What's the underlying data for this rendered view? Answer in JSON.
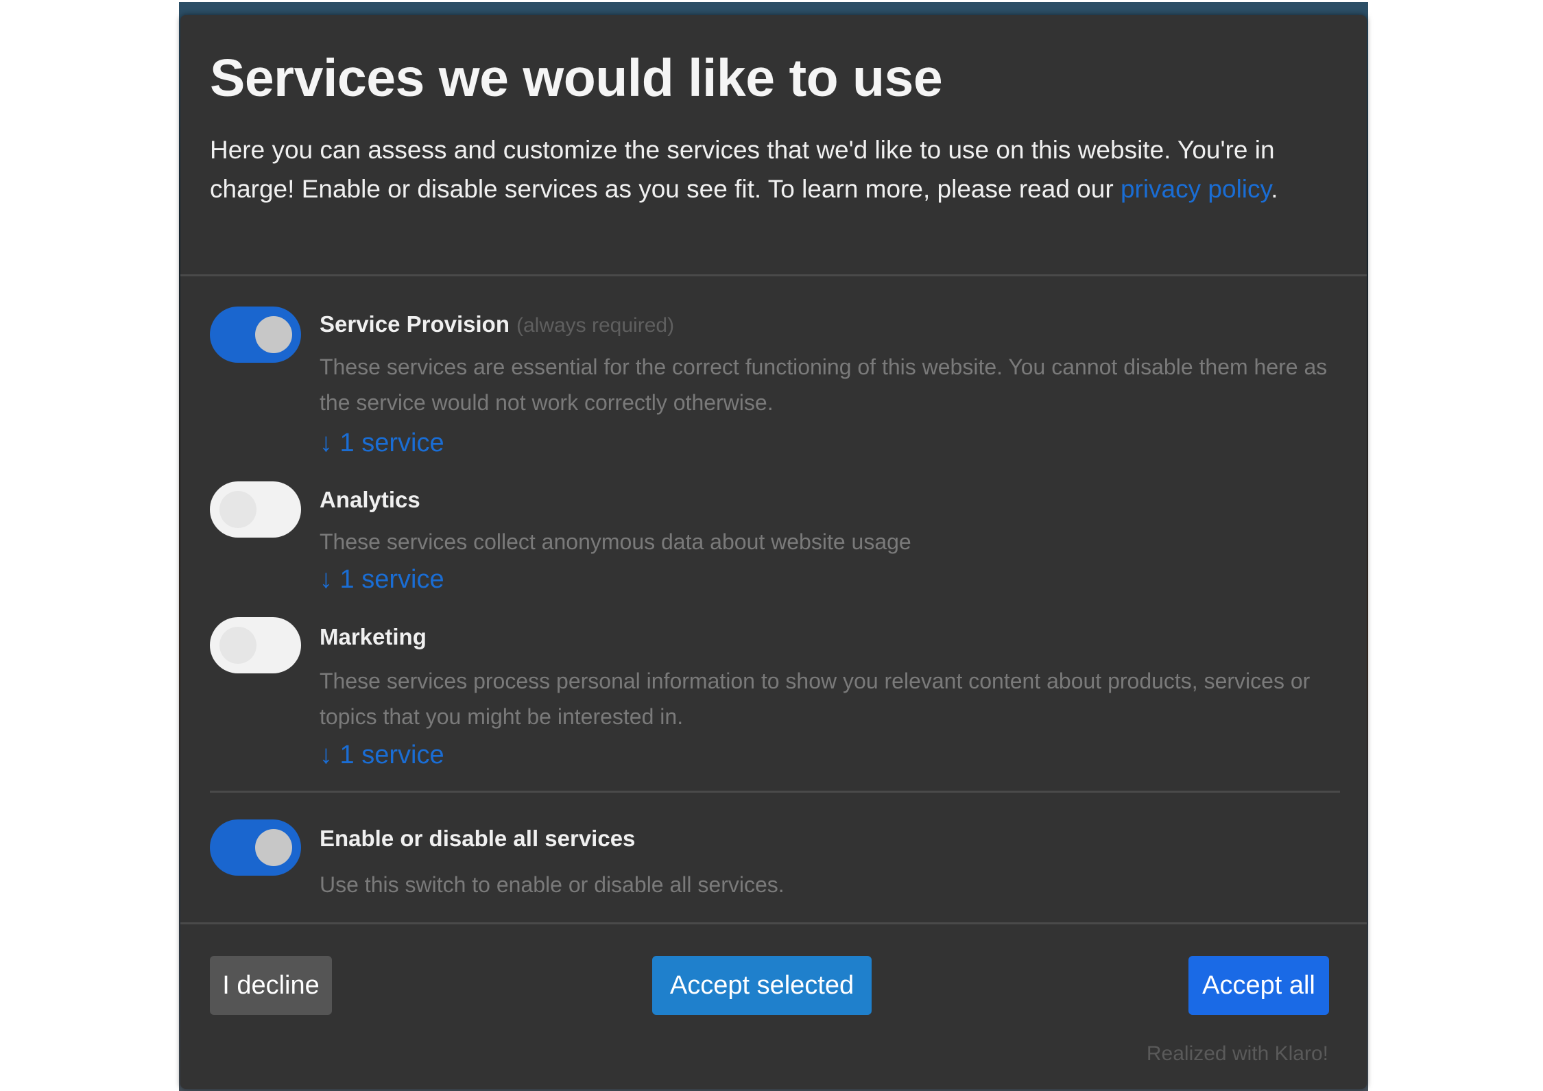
{
  "modal": {
    "title": "Services we would like to use",
    "description_text": "Here you can assess and customize the services that we'd like to use on this website. You're in charge! Enable or disable services as you see fit. To learn more, please read our",
    "privacy_link": "privacy policy",
    "description_end": "."
  },
  "purposes": [
    {
      "name": "Service Provision",
      "required_note": "(always required)",
      "description": "These services are essential for the correct functioning of this website. You cannot disable them here as the service would not work correctly otherwise.",
      "services_link": "↓ 1 service",
      "enabled": true
    },
    {
      "name": "Analytics",
      "description": "These services collect anonymous data about website usage",
      "services_link": "↓ 1 service",
      "enabled": false
    },
    {
      "name": "Marketing",
      "description": "These services process personal information to show you relevant content about products, services or topics that you might be interested in.",
      "services_link": "↓ 1 service",
      "enabled": false
    }
  ],
  "toggle_all": {
    "name": "Enable or disable all services",
    "description": "Use this switch to enable or disable all services.",
    "enabled": true
  },
  "buttons": {
    "decline": "I decline",
    "accept_selected": "Accept selected",
    "accept_all": "Accept all"
  },
  "powered_by": "Realized with Klaro!",
  "colors": {
    "accent": "#1a6dd4",
    "modal_bg": "#333333",
    "toggle_on": "#1a66cf"
  }
}
